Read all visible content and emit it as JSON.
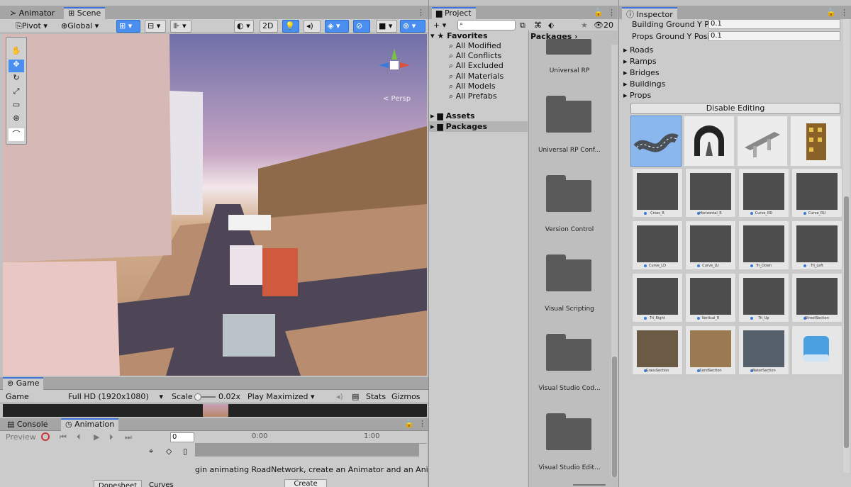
{
  "scene_panel": {
    "tabs": [
      {
        "label": "Animator",
        "icon": "animator-icon"
      },
      {
        "label": "Scene",
        "icon": "scene-grid-icon"
      }
    ],
    "toolbar": {
      "pivot": "Pivot",
      "global": "Global",
      "mode_2d": "2D"
    },
    "persp_label": "< Persp",
    "tools": [
      "hand-tool-icon",
      "move-tool-icon",
      "rotate-tool-icon",
      "scale-tool-icon",
      "rect-tool-icon",
      "transform-tool-icon",
      "custom-tool-icon"
    ]
  },
  "game_panel": {
    "tab": "Game",
    "display": "Game",
    "resolution": "Full HD (1920x1080)",
    "scale_label": "Scale",
    "scale_value": "0.02x",
    "play_mode": "Play Maximized",
    "stats": "Stats",
    "gizmos": "Gizmos"
  },
  "animation_panel": {
    "tabs": [
      "Console",
      "Animation"
    ],
    "preview": "Preview",
    "frame": "0",
    "time_0": "0:00",
    "time_1": "1:00",
    "message": "gin animating RoadNetwork, create an Animator and an Animatic",
    "create": "Create",
    "bottom_tabs": [
      "Dopesheet",
      "Curves"
    ]
  },
  "project_panel": {
    "tab": "Project",
    "search_placeholder": "",
    "count": "20",
    "favorites": "Favorites",
    "fav_items": [
      "All Modified",
      "All Conflicts",
      "All Excluded",
      "All Materials",
      "All Models",
      "All Prefabs"
    ],
    "roots": [
      "Assets",
      "Packages"
    ],
    "breadcrumb": "Packages",
    "folders": [
      "Universal RP",
      "Universal RP Conf...",
      "Version Control",
      "Visual Scripting",
      "Visual Studio Cod...",
      "Visual Studio Edit..."
    ]
  },
  "inspector": {
    "tab": "Inspector",
    "fields": [
      {
        "label": "Building Ground Y Po",
        "value": "0.1"
      },
      {
        "label": "Props Ground Y Posit",
        "value": "0.1"
      }
    ],
    "groups": [
      "Roads",
      "Ramps",
      "Bridges",
      "Buildings",
      "Props"
    ],
    "disable_button": "Disable Editing",
    "categories": [
      "road-category-icon",
      "ramp-tunnel-icon",
      "bridge-category-icon",
      "building-category-icon"
    ],
    "prefabs": [
      "Cross_R",
      "Horizontal_R",
      "Curve_RD",
      "Curve_RU",
      "Curve_LD",
      "Curve_LU",
      "Tri_Down",
      "Tri_Left",
      "Tri_Right",
      "Vertical_R",
      "Tri_Up",
      "StreetSection",
      "GrassSection",
      "SandSection",
      "WaterSection",
      ""
    ]
  }
}
